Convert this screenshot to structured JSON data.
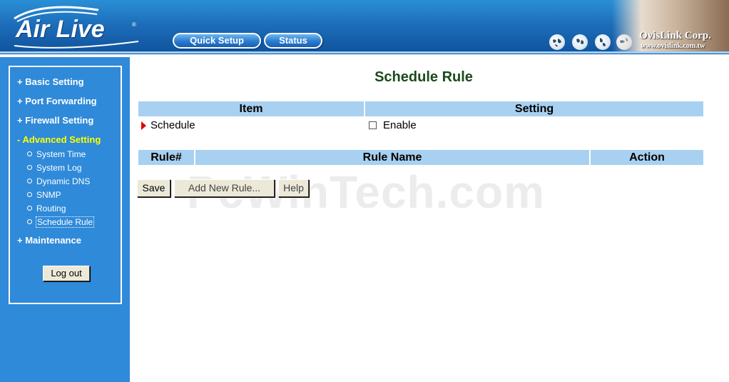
{
  "header": {
    "logo_text": "Air Live",
    "logo_reg": "®",
    "nav_buttons": [
      "Quick Setup",
      "Status"
    ],
    "globe_icons": [
      "globe-icon",
      "globe-icon",
      "globe-icon",
      "globe-icon"
    ],
    "corp_name": "OvisLink Corp.",
    "corp_url": "www.ovislink.com.tw"
  },
  "sidebar": {
    "menu": [
      {
        "label": "+ Basic Setting",
        "active": false
      },
      {
        "label": "+ Port Forwarding",
        "active": false
      },
      {
        "label": "+ Firewall Setting",
        "active": false
      },
      {
        "label": "- Advanced Setting",
        "active": true
      },
      {
        "label": "+ Maintenance",
        "active": false
      }
    ],
    "submenu": [
      {
        "label": "System Time"
      },
      {
        "label": "System Log"
      },
      {
        "label": "Dynamic DNS"
      },
      {
        "label": "SNMP"
      },
      {
        "label": "Routing"
      },
      {
        "label": "Schedule Rule",
        "selected": true
      }
    ],
    "logout_label": "Log out"
  },
  "main": {
    "title": "Schedule Rule",
    "watermark": "PcWinTech.com",
    "settings_table": {
      "headers": [
        "Item",
        "Setting"
      ],
      "row": {
        "item": "Schedule",
        "setting_label": "Enable",
        "enabled": false
      }
    },
    "rules_table": {
      "headers": [
        "Rule#",
        "Rule Name",
        "Action"
      ],
      "rows": []
    },
    "buttons": {
      "save": "Save",
      "add_new_rule": "Add New Rule...",
      "help": "Help"
    }
  },
  "colors": {
    "header_blue": "#1c6cb8",
    "sidebar_blue": "#2f8ad9",
    "table_header": "#a8d0f0",
    "active_menu": "#ffff00",
    "title_green": "#1b4a1b"
  }
}
